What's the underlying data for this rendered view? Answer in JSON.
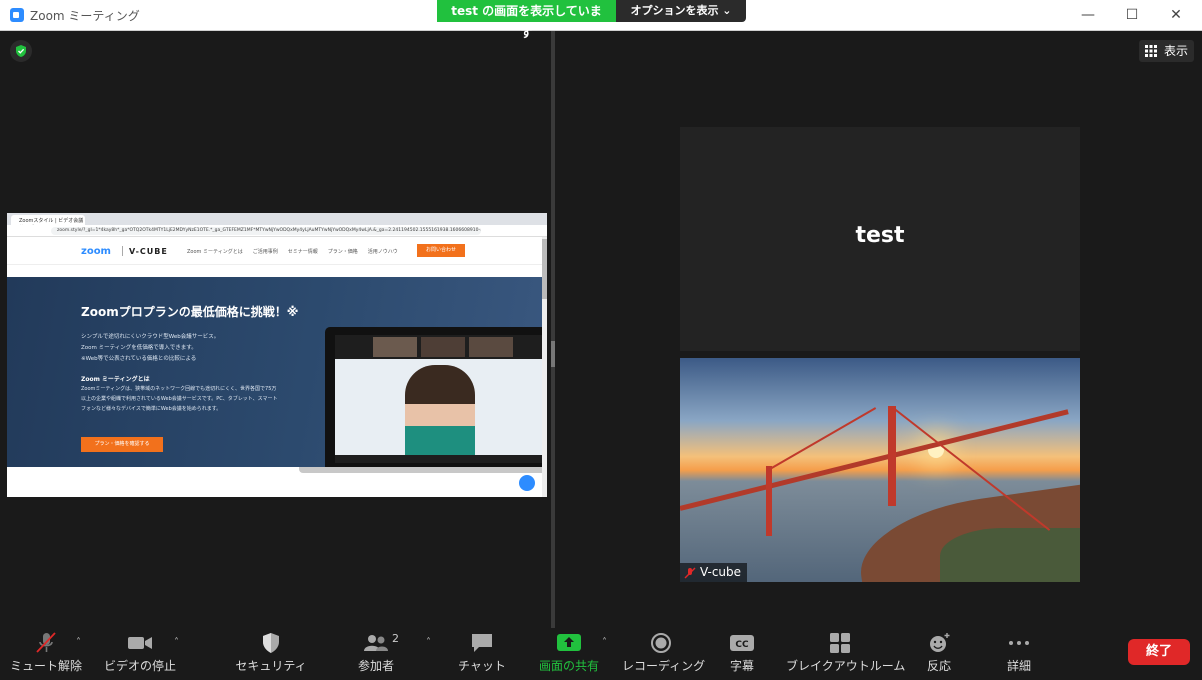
{
  "window": {
    "title": "Zoom ミーティング",
    "controls": {
      "minimize": "—",
      "maximize": "☐",
      "close": "✕"
    }
  },
  "share_banner": {
    "status": "test の画面を表示しています",
    "options": "オプションを表示 ⌄"
  },
  "shared_screen": {
    "tab_title": "Zoomスタイル | ビデオ会議サービス",
    "url": "zoom.style/?_gl=1*4kay8h*_ga*OTQ2OTk4MTY1LjE2MDYyNzE1OTE.*_ga_GTEFEMZ1MF*MTYwNjYwODQxMy4yLjAuMTYwNjYwODQxMy4wLjA.&_ga=2.241194502.1555161938.1606608910-94699165.1606271590&_ads...",
    "logo_zoom": "zoom",
    "logo_vcube": "V-CUBE",
    "nav_links": [
      "Zoom ミーティングとは",
      "ご活用事例",
      "セミナー情報",
      "プラン・価格",
      "活用ノウハウ"
    ],
    "nav_cta": "お問い合わせ",
    "hero_title": "Zoomプロプランの最低価格に挑戦！※",
    "hero_sub": [
      "シンプルで途切れにくいクラウド型Web会議サービス。",
      "Zoom ミーティングを低価格で導入できます。",
      "※Web等で公表されている価格との比較による"
    ],
    "hero_h2": "Zoom ミーティングとは",
    "hero_desc": "Zoomミーティングは、狭帯域のネットワーク回線でも途切れにくく、世界各国で75万以上の企業や組織で利用されているWeb会議サービスです。PC、タブレット、スマートフォンなど様々なデバイスで簡単にWeb会議を始められます。",
    "hero_btn": "プラン・価格を確認する"
  },
  "participants": [
    {
      "name": "test",
      "video": false
    },
    {
      "name": "V-cube",
      "video": true,
      "muted": true
    }
  ],
  "view_button": "表示",
  "toolbar": {
    "items": [
      {
        "label": "ミュート解除",
        "icon": "mic-muted-icon",
        "caret": "˄"
      },
      {
        "label": "ビデオの停止",
        "icon": "video-camera-icon",
        "caret": "˄"
      },
      {
        "label": "セキュリティ",
        "icon": "shield-icon"
      },
      {
        "label": "参加者",
        "icon": "participants-icon",
        "count": "2",
        "caret": "˄"
      },
      {
        "label": "チャット",
        "icon": "chat-icon"
      },
      {
        "label": "画面の共有",
        "icon": "share-screen-icon",
        "caret": "˄"
      },
      {
        "label": "レコーディング",
        "icon": "record-icon"
      },
      {
        "label": "字幕",
        "icon": "cc-icon"
      },
      {
        "label": "ブレイクアウトルーム",
        "icon": "breakout-icon"
      },
      {
        "label": "反応",
        "icon": "reaction-icon"
      },
      {
        "label": "詳細",
        "icon": "more-icon"
      }
    ],
    "end_label": "終了"
  },
  "colors": {
    "accent_green": "#21c13e",
    "end_red": "#e02828",
    "zoom_blue": "#2d8cff"
  }
}
